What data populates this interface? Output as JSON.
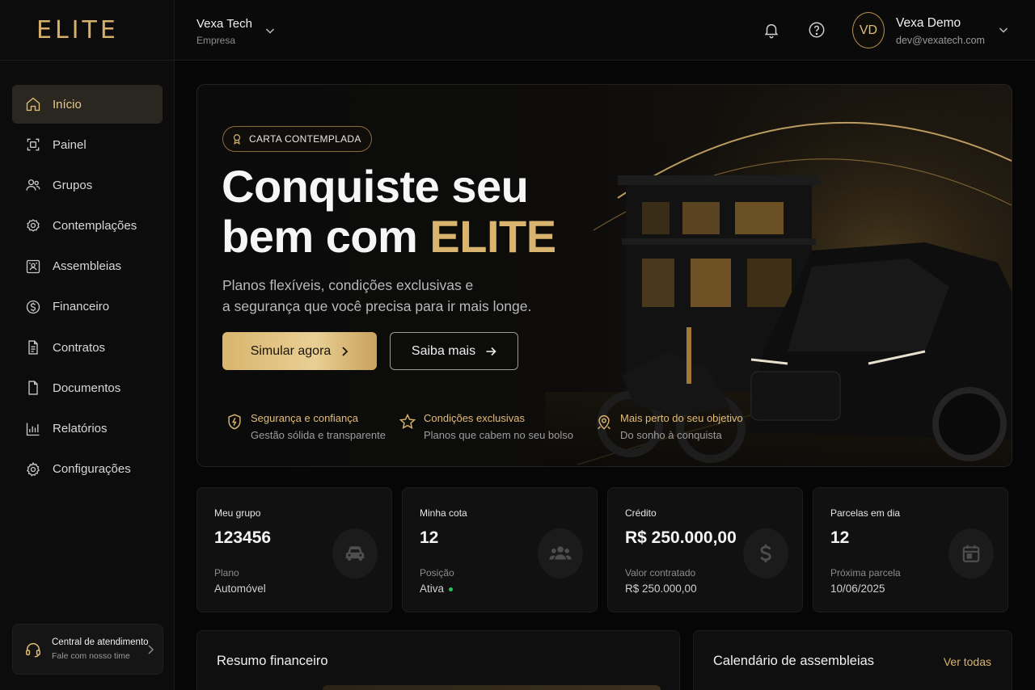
{
  "brand": {
    "logo_text": "ELITE"
  },
  "sidebar": {
    "items": [
      {
        "label": "Início",
        "icon": "home-icon",
        "active": true
      },
      {
        "label": "Painel",
        "icon": "dashboard-icon"
      },
      {
        "label": "Grupos",
        "icon": "users-icon"
      },
      {
        "label": "Contemplações",
        "icon": "award-icon"
      },
      {
        "label": "Assembleias",
        "icon": "assembly-icon"
      },
      {
        "label": "Financeiro",
        "icon": "dollar-icon"
      },
      {
        "label": "Contratos",
        "icon": "contract-icon"
      },
      {
        "label": "Documentos",
        "icon": "document-icon"
      },
      {
        "label": "Relatórios",
        "icon": "chart-icon"
      },
      {
        "label": "Configurações",
        "icon": "gear-icon"
      }
    ],
    "support": {
      "title": "Central de atendimento",
      "subtitle": "Fale com nosso time",
      "icon": "headset-icon"
    }
  },
  "topbar": {
    "company_name": "Vexa Tech",
    "company_type": "Empresa",
    "avatar_initials": "VD",
    "user_name": "Vexa Demo",
    "user_email": "dev@vexatech.com"
  },
  "hero": {
    "badge": "CARTA CONTEMPLADA",
    "headline_line1": "Conquiste seu",
    "headline_line2_prefix": "bem com ",
    "headline_line2_accent": "ELITE",
    "description_line1": "Planos flexíveis, condições exclusivas e",
    "description_line2": "a segurança que você precisa para ir mais longe.",
    "primary_button": "Simular agora",
    "secondary_button": "Saiba mais",
    "features": [
      {
        "title": "Segurança e confiança",
        "subtitle": "Gestão sólida e transparente",
        "icon": "shield-icon"
      },
      {
        "title": "Condições exclusivas",
        "subtitle": "Planos que cabem no seu bolso",
        "icon": "star-icon"
      },
      {
        "title": "Mais perto do seu objetivo",
        "subtitle": "Do sonho à conquista",
        "icon": "target-icon"
      }
    ]
  },
  "stats": [
    {
      "label": "Meu grupo",
      "value": "123456",
      "sublabel": "Plano",
      "subvalue": "Automóvel",
      "icon": "car-icon"
    },
    {
      "label": "Minha cota",
      "value": "12",
      "sublabel": "Posição",
      "subvalue": "Ativa",
      "icon": "group-icon"
    },
    {
      "label": "Crédito",
      "value": "R$ 250.000,00",
      "sublabel": "Valor contratado",
      "subvalue": "R$ 250.000,00",
      "icon": "dollar-sign-icon"
    },
    {
      "label": "Parcelas em dia",
      "value": "12",
      "sublabel": "Próxima parcela",
      "subvalue": "10/06/2025",
      "icon": "calendar-icon"
    }
  ],
  "panels": {
    "financial_title": "Resumo financeiro",
    "calendar_title": "Calendário de assembleias",
    "calendar_link": "Ver todas"
  },
  "colors": {
    "accent_gold": "#d8b46e",
    "background": "#060606",
    "status_active": "#22c55e"
  }
}
